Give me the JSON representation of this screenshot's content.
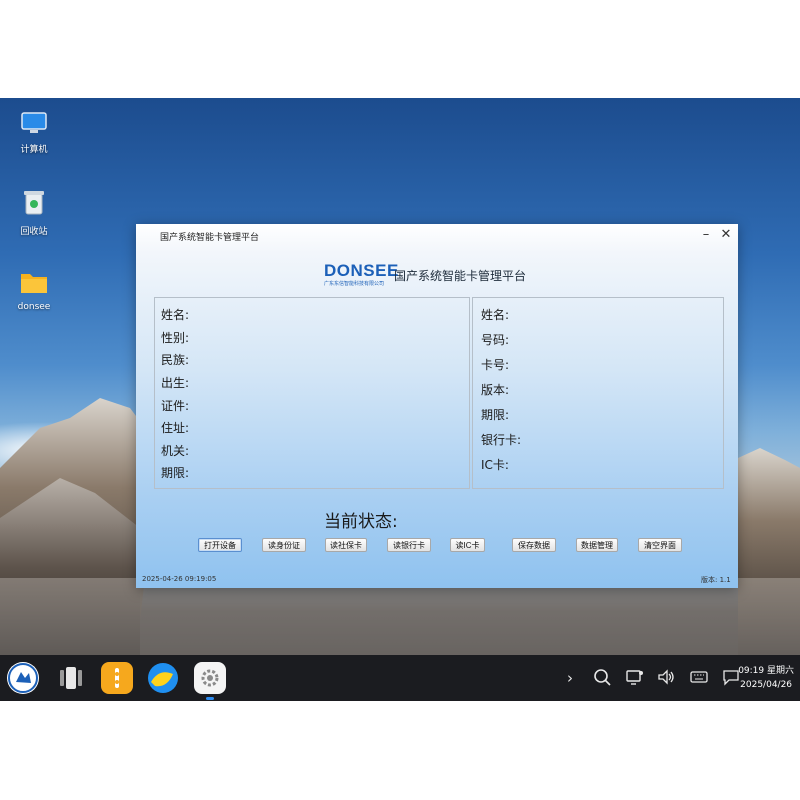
{
  "desktop": {
    "icons": [
      {
        "label": "计算机"
      },
      {
        "label": "回收站"
      },
      {
        "label": "donsee"
      }
    ]
  },
  "window": {
    "title": "国产系统智能卡管理平台",
    "logo_mark": "DONSEE",
    "logo_sub": "广东东信智能科技有限公司",
    "app_title": "国产系统智能卡管理平台",
    "id_card_fields": [
      "姓名:",
      "性别:",
      "民族:",
      "出生:",
      "证件:",
      "住址:",
      "机关:",
      "期限:"
    ],
    "card_fields": [
      "姓名:",
      "号码:",
      "卡号:",
      "版本:",
      "期限:",
      "银行卡:",
      "IC卡:"
    ],
    "status_label": "当前状态:",
    "buttons": [
      "打开设备",
      "读身份证",
      "读社保卡",
      "读银行卡",
      "读IC卡",
      "保存数据",
      "数据管理",
      "清空界面"
    ],
    "timestamp": "2025-04-26 09:19:05",
    "version": "版本: 1.1"
  },
  "taskbar": {
    "tray_icons": [
      "chevron-right-icon",
      "search-icon",
      "monitor-icon",
      "volume-icon",
      "keyboard-icon",
      "notification-icon"
    ],
    "clock_time": "09:19 星期六",
    "clock_date": "2025/04/26"
  },
  "colors": {
    "accent": "#1c60b8",
    "taskbar": "#1b1c20"
  }
}
